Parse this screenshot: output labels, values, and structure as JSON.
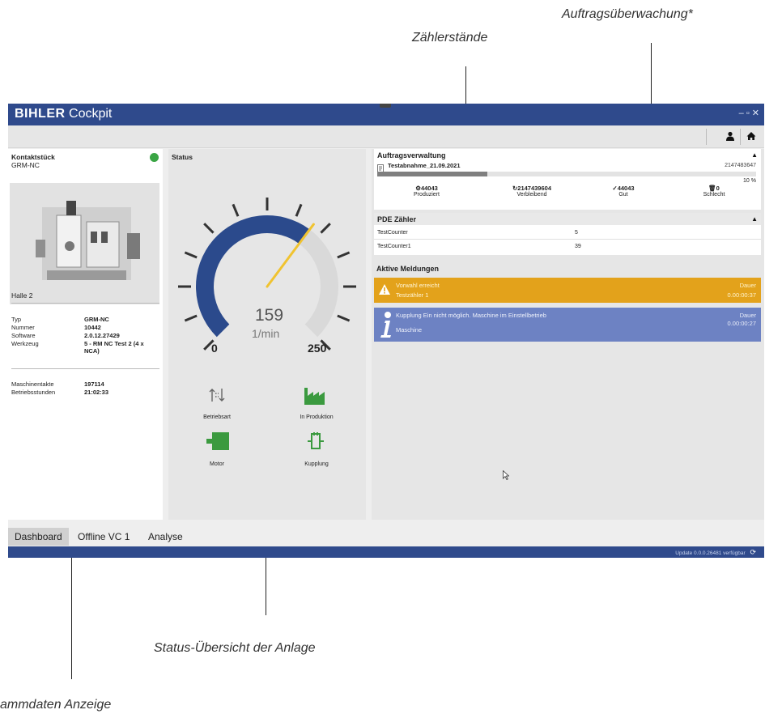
{
  "callouts": {
    "auftrag": "Auftragsüberwachung*",
    "zaehler": "Zählerstände",
    "status": "Status-Übersicht der Anlage",
    "stamm": "ammdaten Anzeige"
  },
  "app": {
    "brand_bold": "BIHLER",
    "brand_rest": "Cockpit",
    "window_controls": "– ▫ ✕"
  },
  "left": {
    "part_name": "Kontaktstück",
    "part_code": "GRM-NC",
    "hall": "Halle 2",
    "info": [
      {
        "label": "Typ",
        "value": "GRM-NC"
      },
      {
        "label": "Nummer",
        "value": "10442"
      },
      {
        "label": "Software",
        "value": "2.0.12.27429"
      },
      {
        "label": "Werkzeug",
        "value": "5 - RM NC Test 2 (4 x NCA)"
      }
    ],
    "stats": [
      {
        "label": "Maschinentakte",
        "value": "197114"
      },
      {
        "label": "Betriebsstunden",
        "value": "21:02:33"
      }
    ]
  },
  "status": {
    "title": "Status",
    "gauge_value": "159",
    "gauge_unit": "1/min",
    "gauge_min": "0",
    "gauge_max": "250",
    "gauge_fraction": 0.636,
    "indicators": [
      {
        "label": "Betriebsart",
        "icon": "mode-switch-icon"
      },
      {
        "label": "In Produktion",
        "icon": "factory-icon"
      },
      {
        "label": "Motor",
        "icon": "motor-icon"
      },
      {
        "label": "Kupplung",
        "icon": "coupling-icon"
      }
    ]
  },
  "auftrag": {
    "title": "Auftragsverwaltung",
    "order_name": "Testabnahme_21.09.2021",
    "order_total": "2147483647",
    "percent_label": "10 %",
    "progress": 0.29,
    "counters": [
      {
        "value": "44043",
        "label": "Produziert",
        "icon": "gear-icon"
      },
      {
        "value": "2147439604",
        "label": "Verbleibend",
        "icon": "cycle-icon"
      },
      {
        "value": "44043",
        "label": "Gut",
        "icon": "check-icon"
      },
      {
        "value": "0",
        "label": "Schlecht",
        "icon": "trash-icon"
      }
    ]
  },
  "pde": {
    "title": "PDE Zähler",
    "rows": [
      {
        "name": "TestCounter",
        "value": "5"
      },
      {
        "name": "TestCounter1",
        "value": "39"
      }
    ]
  },
  "meldungen": {
    "title": "Aktive Meldungen",
    "items": [
      {
        "type": "warn",
        "title": "Vorwahl erreicht",
        "sub": "Testzähler 1",
        "dur_label": "Dauer",
        "dur": "0.00:00:37"
      },
      {
        "type": "info",
        "title": "Kupplung Ein nicht möglich. Maschine im Einstellbetrieb",
        "sub": "Maschine",
        "dur_label": "Dauer",
        "dur": "0.00:00:27"
      }
    ]
  },
  "tabs": [
    "Dashboard",
    "Offline VC 1",
    "Analyse"
  ],
  "bottom": {
    "update": "Update 0.0.0.26481 verfügbar"
  }
}
